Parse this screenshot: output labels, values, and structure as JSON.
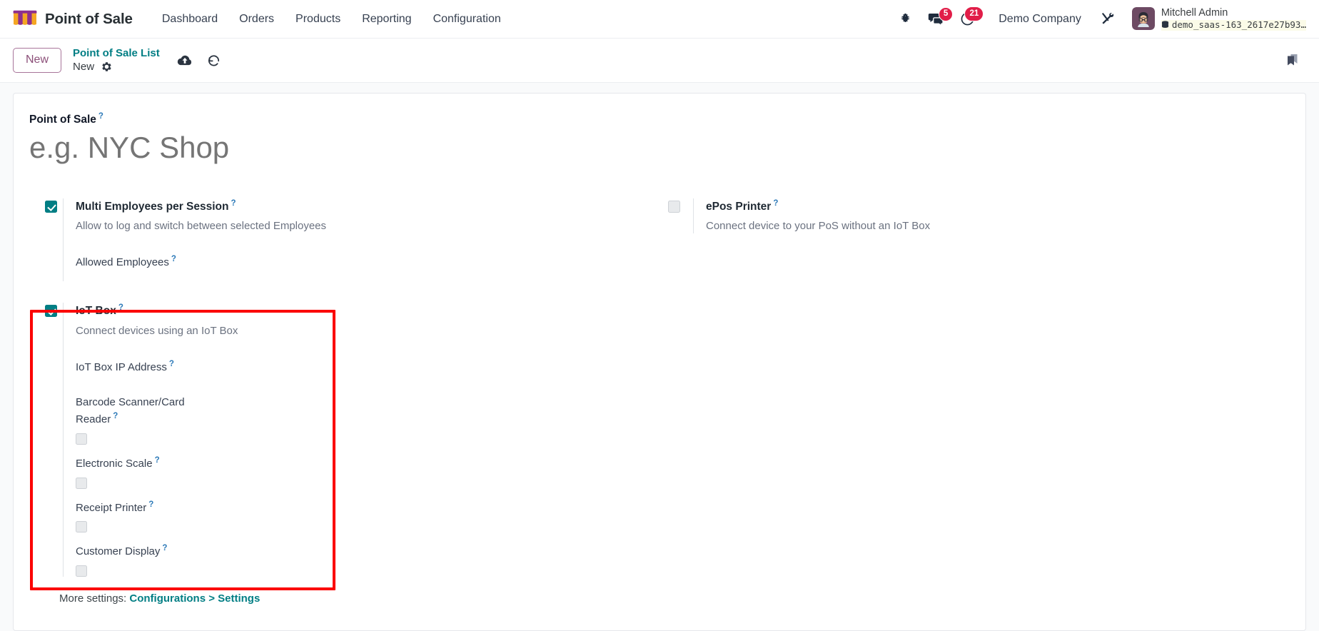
{
  "navbar": {
    "logo_icon": "pos-awning-icon",
    "brand": "Point of Sale",
    "menu": [
      {
        "label": "Dashboard"
      },
      {
        "label": "Orders"
      },
      {
        "label": "Products"
      },
      {
        "label": "Reporting"
      },
      {
        "label": "Configuration"
      }
    ],
    "sys_icons": [
      {
        "name": "bug-icon",
        "badge": ""
      },
      {
        "name": "messages-icon",
        "badge": "5"
      },
      {
        "name": "activities-clock-icon",
        "badge": "21"
      }
    ],
    "company": "Demo Company",
    "tools_icon": "wrench-screwdriver-icon",
    "user": {
      "name": "Mitchell Admin",
      "database": "demo_saas-163_2617e27b93…",
      "database_icon": "database-icon",
      "avatar_icon": "user-avatar"
    }
  },
  "control_panel": {
    "new_button": "New",
    "breadcrumb_parent": "Point of Sale List",
    "breadcrumb_current": "New",
    "gear_icon": "gear-icon",
    "save_icon": "cloud-upload-icon",
    "discard_icon": "undo-arrow-icon",
    "bookmark_icon": "bookmark-icon"
  },
  "form": {
    "name_label": "Point of Sale",
    "name_value": "",
    "name_placeholder": "e.g. NYC Shop",
    "left_column": [
      {
        "id": "multi-employees",
        "title": "Multi Employees per Session",
        "description": "Allow to log and switch between selected Employees",
        "checked": true,
        "subfields": [
          {
            "id": "allowed-employees",
            "label": "Allowed Employees",
            "type": "input",
            "value": ""
          }
        ]
      },
      {
        "id": "iot-box",
        "title": "IoT Box",
        "description": "Connect devices using an IoT Box",
        "checked": true,
        "subfields": [
          {
            "id": "iot-ip",
            "label": "IoT Box IP Address",
            "type": "input",
            "value": ""
          },
          {
            "id": "barcode-scanner",
            "label": "Barcode Scanner/Card Reader",
            "type": "checkbox",
            "checked": false
          },
          {
            "id": "electronic-scale",
            "label": "Electronic Scale",
            "type": "checkbox",
            "checked": false
          },
          {
            "id": "receipt-printer",
            "label": "Receipt Printer",
            "type": "checkbox",
            "checked": false
          },
          {
            "id": "customer-display",
            "label": "Customer Display",
            "type": "checkbox",
            "checked": false
          }
        ]
      }
    ],
    "right_column": [
      {
        "id": "epos-printer",
        "title": "ePos Printer",
        "description": "Connect device to your PoS without an IoT Box",
        "checked": false
      }
    ],
    "more_settings_prefix": "More settings:",
    "more_settings_link": "Configurations > Settings",
    "tooltip_marker": "?"
  },
  "colors": {
    "accent_teal": "#017e84",
    "brand_purple": "#8b4f78",
    "badge_red": "#e11d48",
    "annotation_red": "#fb0000",
    "help_blue": "#2d7ab8"
  }
}
